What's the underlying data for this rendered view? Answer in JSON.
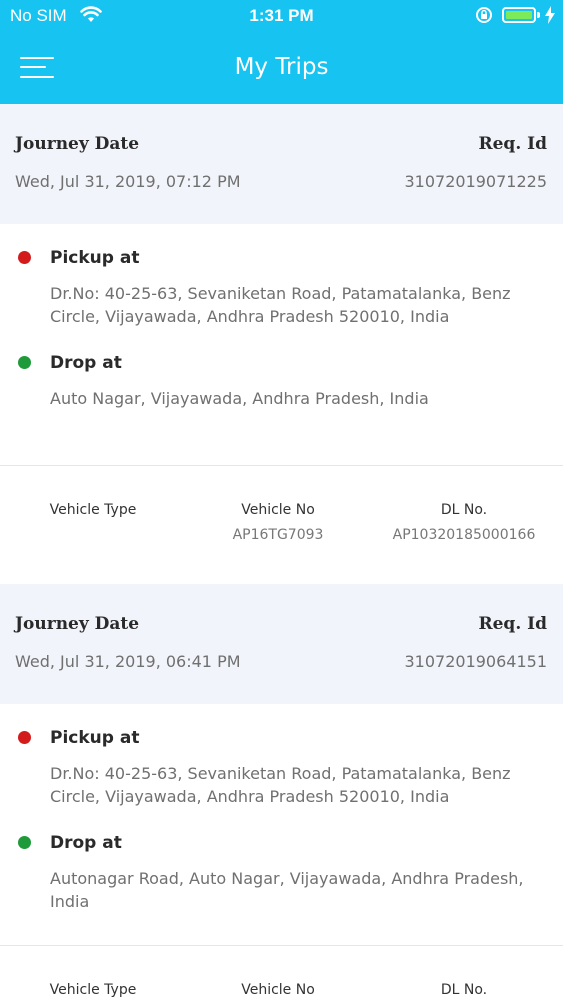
{
  "status_bar": {
    "carrier": "No SIM",
    "time": "1:31 PM"
  },
  "header": {
    "title": "My Trips"
  },
  "labels": {
    "journey_date": "Journey Date",
    "req_id": "Req. Id",
    "pickup": "Pickup at",
    "drop": "Drop at",
    "vehicle_type": "Vehicle Type",
    "vehicle_no": "Vehicle No",
    "dl_no": "DL No."
  },
  "colors": {
    "header": "#17c3f0",
    "pickup_dot": "#d41b1b",
    "drop_dot": "#1f9a3a"
  },
  "trips": [
    {
      "journey_date": "Wed, Jul 31, 2019, 07:12 PM",
      "req_id": "31072019071225",
      "pickup_address": "Dr.No: 40-25-63, Sevaniketan Road, Patamatalanka, Benz Circle, Vijayawada, Andhra Pradesh 520010, India",
      "drop_address": "Auto Nagar, Vijayawada, Andhra Pradesh, India",
      "vehicle_type": "",
      "vehicle_no": "AP16TG7093",
      "dl_no": "AP10320185000166"
    },
    {
      "journey_date": "Wed, Jul 31, 2019, 06:41 PM",
      "req_id": "31072019064151",
      "pickup_address": "Dr.No: 40-25-63, Sevaniketan Road, Patamatalanka, Benz Circle, Vijayawada, Andhra Pradesh 520010, India",
      "drop_address": "Autonagar Road, Auto Nagar, Vijayawada, Andhra Pradesh, India",
      "vehicle_type": "",
      "vehicle_no": "",
      "dl_no": ""
    }
  ]
}
